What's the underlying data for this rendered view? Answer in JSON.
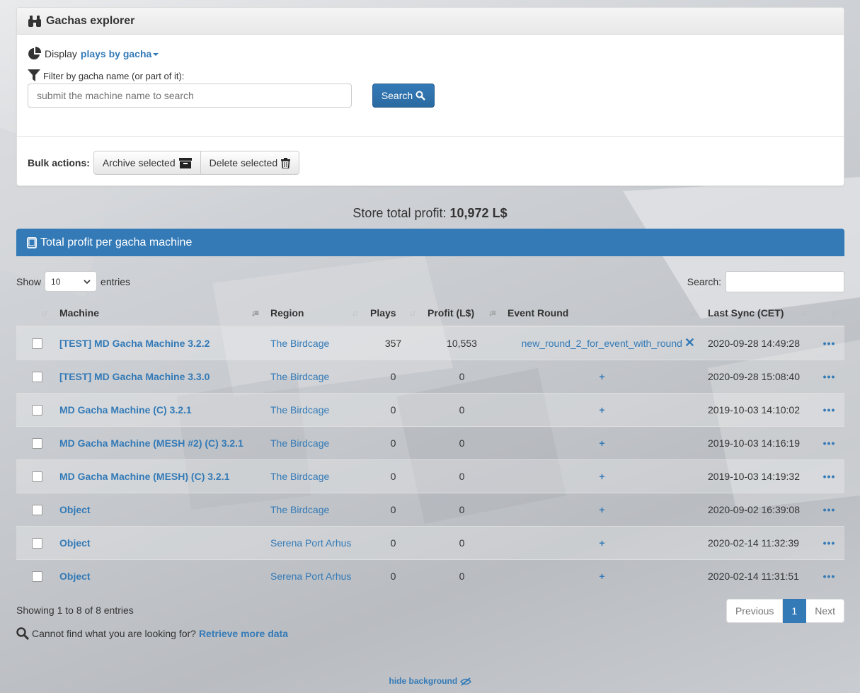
{
  "header": {
    "title": "Gachas explorer"
  },
  "display": {
    "label": "Display",
    "selected": "plays by gacha"
  },
  "filter": {
    "label": "Filter by gacha name (or part of it):",
    "placeholder": "submit the machine name to search",
    "button": "Search"
  },
  "bulk": {
    "label": "Bulk actions:",
    "archive": "Archive selected",
    "delete": "Delete selected"
  },
  "store_total": {
    "label": "Store total profit:",
    "value": "10,972 L$"
  },
  "table_panel": {
    "title": "Total profit per gacha machine"
  },
  "length": {
    "show": "Show",
    "value": "10",
    "entries": "entries"
  },
  "search": {
    "label": "Search:"
  },
  "columns": [
    "Machine",
    "Region",
    "Plays",
    "Profit (L$)",
    "Event Round",
    "Last Sync (CET)"
  ],
  "rows": [
    {
      "machine": "[TEST] MD Gacha Machine 3.2.2",
      "region": "The Birdcage",
      "plays": "357",
      "profit": "10,553",
      "event": "new_round_2_for_event_with_round",
      "sync": "2020-09-28 14:49:28"
    },
    {
      "machine": "[TEST] MD Gacha Machine 3.3.0",
      "region": "The Birdcage",
      "plays": "0",
      "profit": "0",
      "event": "",
      "sync": "2020-09-28 15:08:40"
    },
    {
      "machine": "MD Gacha Machine (C) 3.2.1",
      "region": "The Birdcage",
      "plays": "0",
      "profit": "0",
      "event": "",
      "sync": "2019-10-03 14:10:02"
    },
    {
      "machine": "MD Gacha Machine (MESH #2) (C) 3.2.1",
      "region": "The Birdcage",
      "plays": "0",
      "profit": "0",
      "event": "",
      "sync": "2019-10-03 14:16:19"
    },
    {
      "machine": "MD Gacha Machine (MESH) (C) 3.2.1",
      "region": "The Birdcage",
      "plays": "0",
      "profit": "0",
      "event": "",
      "sync": "2019-10-03 14:19:32"
    },
    {
      "machine": "Object",
      "region": "The Birdcage",
      "plays": "0",
      "profit": "0",
      "event": "",
      "sync": "2020-09-02 16:39:08"
    },
    {
      "machine": "Object",
      "region": "Serena Port Arhus",
      "plays": "0",
      "profit": "0",
      "event": "",
      "sync": "2020-02-14 11:32:39"
    },
    {
      "machine": "Object",
      "region": "Serena Port Arhus",
      "plays": "0",
      "profit": "0",
      "event": "",
      "sync": "2020-02-14 11:31:51"
    }
  ],
  "info": "Showing 1 to 8 of 8 entries",
  "pager": {
    "prev": "Previous",
    "current": "1",
    "next": "Next"
  },
  "retrieve": {
    "text": "Cannot find what you are looking for?",
    "link": "Retrieve more data"
  },
  "footer": {
    "hide_bg": "hide background"
  },
  "colors": {
    "primary": "#337ab7"
  }
}
